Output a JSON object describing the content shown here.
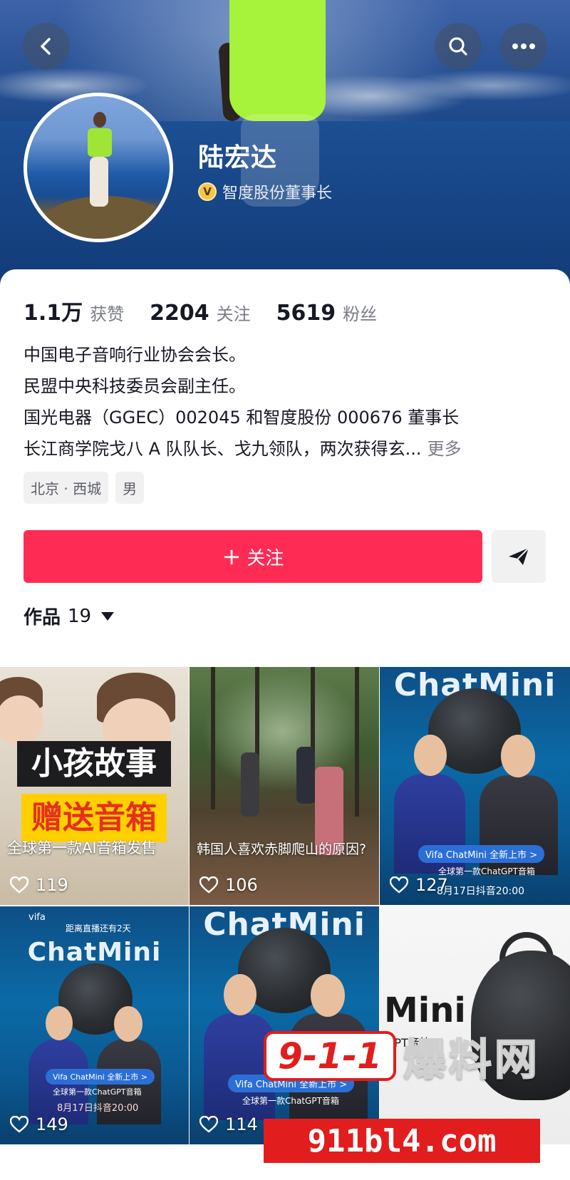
{
  "header": {
    "name": "陆宏达",
    "verification": "智度股份董事长"
  },
  "stats": [
    {
      "value": "1.1万",
      "label": "获赞"
    },
    {
      "value": "2204",
      "label": "关注"
    },
    {
      "value": "5619",
      "label": "粉丝"
    }
  ],
  "bio": {
    "lines": [
      "中国电子音响行业协会会长。",
      "民盟中央科技委员会副主任。",
      "国光电器（GGEC）002045 和智度股份 000676 董事长",
      "长江商学院戈八 A 队队长、戈九领队，两次获得玄..."
    ],
    "more_label": "更多"
  },
  "tags": [
    "北京 · 西城",
    "男"
  ],
  "actions": {
    "follow_label": "关注",
    "plus": "+"
  },
  "works": {
    "label": "作品",
    "count": "19"
  },
  "videos": [
    {
      "likes": "119",
      "caption": "全球第一款AI音箱发售",
      "banner_top": "小孩故事",
      "banner_bottom": "赠送音箱"
    },
    {
      "likes": "106",
      "caption": "韩国人喜欢赤脚爬山的原因?"
    },
    {
      "likes": "127",
      "brand": "ChatMini",
      "pill": "Vifa ChatMini 全新上市 >",
      "sub": "全球第一款ChatGPT音箱",
      "date": "8月17日抖音20:00"
    },
    {
      "likes": "149",
      "brand": "ChatMini",
      "top_small": "vifa",
      "countdown": "距离直播还有2天",
      "pill": "Vifa ChatMini 全新上市 >",
      "sub": "全球第一款ChatGPT音箱",
      "date": "8月17日抖音20:00"
    },
    {
      "likes": "114",
      "brand": "ChatMini",
      "pill": "Vifa ChatMini 全新上市 >",
      "sub": "全球第一款ChatGPT音箱"
    },
    {
      "brand": "Mini",
      "sub": "GPT音箱"
    }
  ],
  "watermark": {
    "badge": "9-1-1",
    "site_name": "爆料网",
    "url": "911bl4.com"
  },
  "colors": {
    "follow_button": "#fe2c55",
    "verify_badge": "#f2c64a"
  }
}
